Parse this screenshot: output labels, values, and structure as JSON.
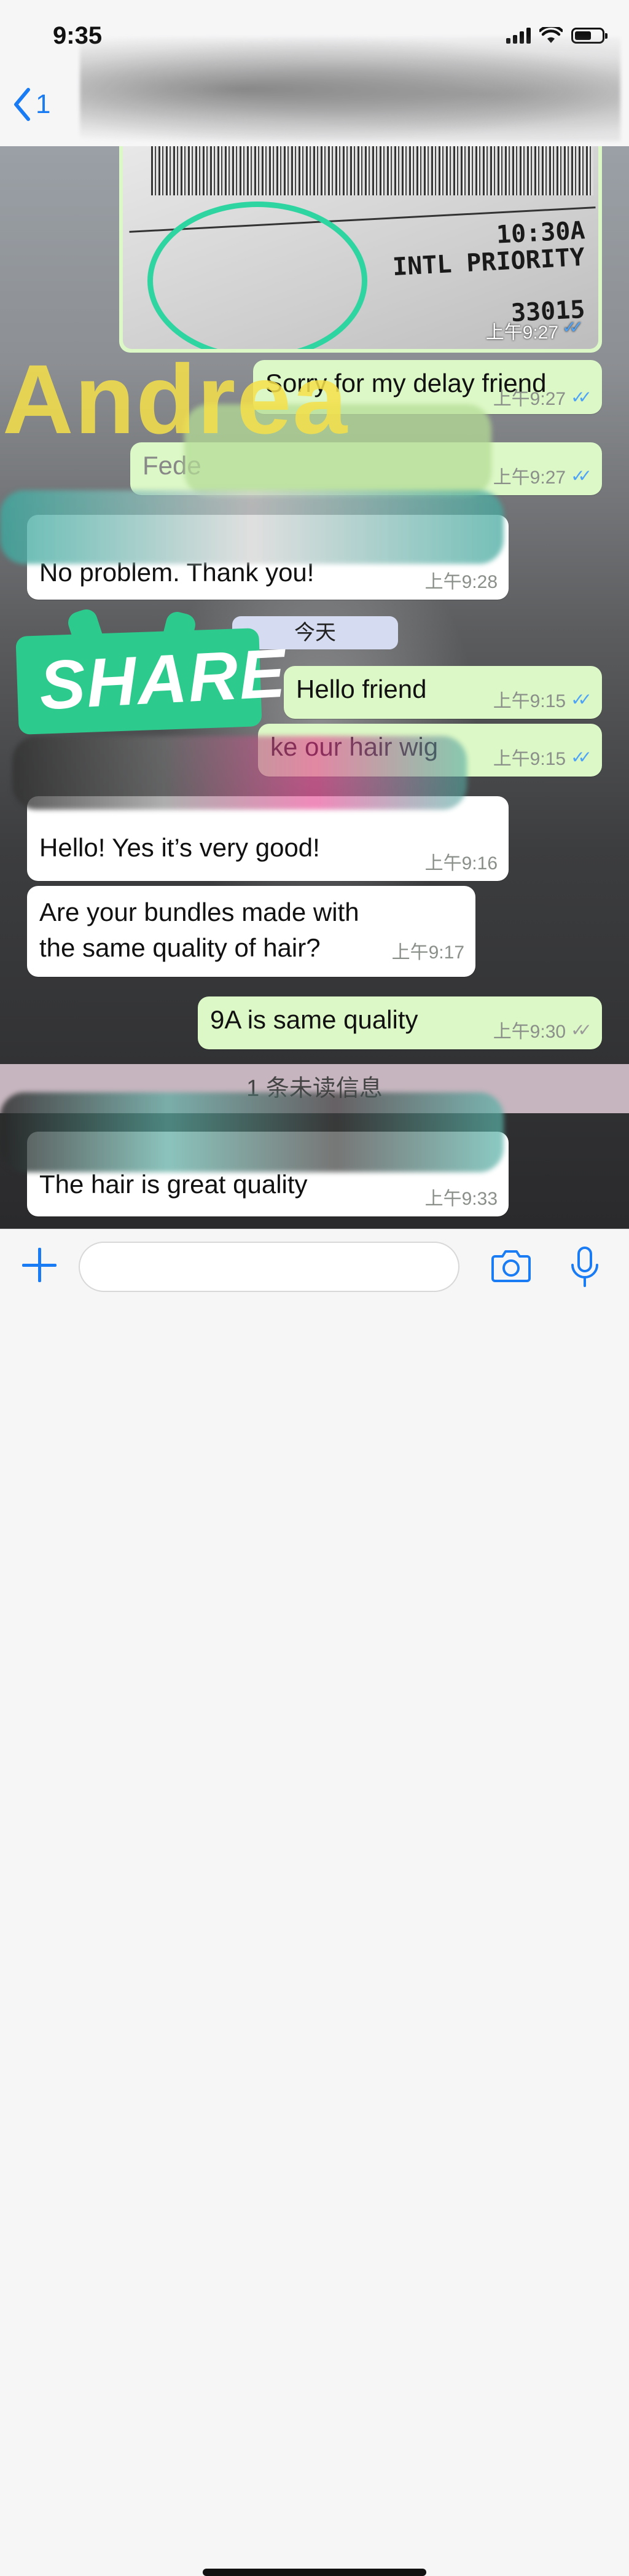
{
  "status_bar": {
    "time": "9:35"
  },
  "header": {
    "back_count": "1"
  },
  "chat": {
    "image_message": {
      "lines": [
        "10:30A",
        "INTL PRIORITY",
        "33015"
      ],
      "time": "上午9:27"
    },
    "messages": [
      {
        "text": "Sorry for my delay friend",
        "time": "上午9:27"
      },
      {
        "text": "Fede",
        "time": "上午9:27"
      },
      {
        "text": "No problem. Thank you!",
        "time": "上午9:28"
      },
      {
        "text": "Hello friend",
        "time": "上午9:15"
      },
      {
        "text": "ke our hair wig",
        "time": "上午9:15"
      },
      {
        "text": "Hello! Yes it’s very good!",
        "time": "上午9:16"
      },
      {
        "text": "Are your bundles made with the same quality of hair?",
        "time": "上午9:17"
      },
      {
        "text": "9A is same quality",
        "time": "上午9:30"
      },
      {
        "text": "The hair is great quality",
        "time": "上午9:33"
      }
    ],
    "date_separator": "今天",
    "unread_banner": "1 条未读信息"
  },
  "overlays": {
    "name_watermark": "Andrea",
    "sticker_text": "SHARE"
  },
  "colors": {
    "accent": "#1a7cf4",
    "outgoing_bubble": "#dcf8c6",
    "incoming_bubble": "#ffffff",
    "read_ticks": "#4fa3f7",
    "sticker": "#2dca8d",
    "watermark": "#f6e14a"
  },
  "icons": [
    "back-chevron-icon",
    "signal-icon",
    "wifi-icon",
    "battery-icon",
    "plus-icon",
    "camera-icon",
    "microphone-icon"
  ]
}
